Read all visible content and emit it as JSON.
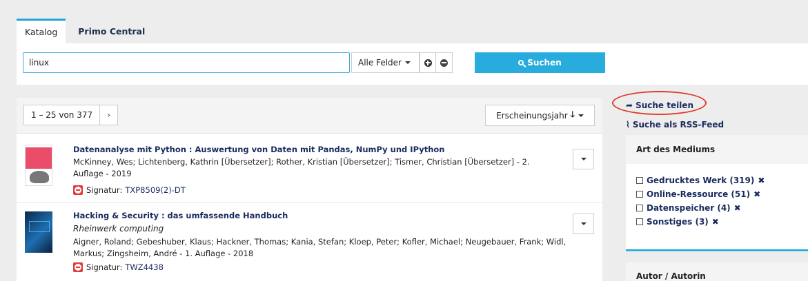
{
  "tabs": [
    {
      "label": "Katalog",
      "active": true
    },
    {
      "label": "Primo Central",
      "active": false
    }
  ],
  "search": {
    "query": "linux",
    "field_label": "Alle Felder",
    "button_label": "Suchen",
    "accent": "#28acdd"
  },
  "results": {
    "count_label": "1 – 25 von 377",
    "next_label": "›",
    "sort_label": "Erscheinungsjahr",
    "records": [
      {
        "title": "Datenanalyse mit Python : Auswertung von Daten mit Pandas, NumPy und IPython",
        "series": "",
        "authors": "McKinney, Wes; Lichtenberg, Kathrin [Übersetzer]; Rother, Kristian [Übersetzer]; Tismer, Christian [Übersetzer] - 2. Auflage - 2019",
        "signature_label": "Signatur:",
        "signature": "TXP8509(2)-DT"
      },
      {
        "title": "Hacking & Security : das umfassende Handbuch",
        "series": "Rheinwerk computing",
        "authors": "Aigner, Roland; Gebeshuber, Klaus; Hackner, Thomas; Kania, Stefan; Kloep, Peter; Kofler, Michael; Neugebauer, Frank; Widl, Markus; Zingsheim, André - 1. Auflage - 2018",
        "signature_label": "Signatur:",
        "signature": "TWZ4438"
      }
    ]
  },
  "sidebar": {
    "share_label": "Suche teilen",
    "rss_label": "Suche als RSS-Feed",
    "facet_title": "Art des Mediums",
    "facet_items": [
      {
        "label": "Gedrucktes Werk (319)"
      },
      {
        "label": "Online-Ressource (51)"
      },
      {
        "label": "Datenspeicher (4)"
      },
      {
        "label": "Sonstiges (3)"
      }
    ],
    "facet2_title": "Autor / Autorin",
    "highlight_color": "#e33a2a"
  }
}
